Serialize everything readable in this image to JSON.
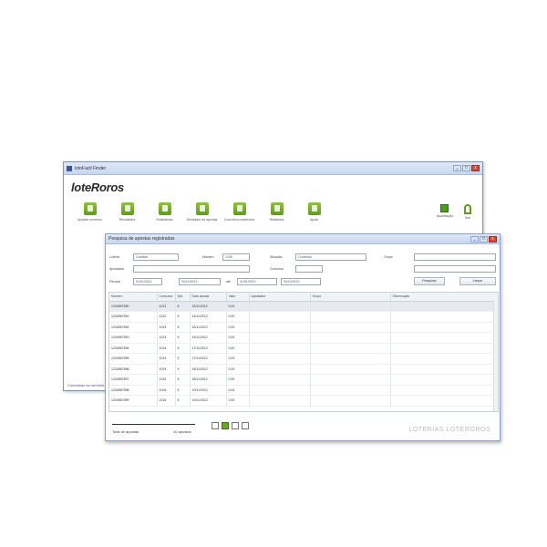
{
  "main_window": {
    "title": "lotoFacil Finder",
    "controls": [
      "_",
      "□",
      "x"
    ],
    "logo": "loteRoros",
    "toolbar": [
      {
        "label": "Apostar números",
        "icon": "bet-icon"
      },
      {
        "label": "Resultados",
        "icon": "results-icon"
      },
      {
        "label": "Estatísticas",
        "icon": "stats-icon"
      },
      {
        "label": "Simulador de apostas",
        "icon": "simulator-icon"
      },
      {
        "label": "Concursos anteriores",
        "icon": "contests-icon"
      },
      {
        "label": "Relatórios",
        "icon": "reports-icon"
      },
      {
        "label": "Ajuda",
        "icon": "help-icon"
      }
    ],
    "right_tools": {
      "update_label": "Atualização",
      "exit_label": "Sair"
    },
    "status": "Conectado ao servidor"
  },
  "dialog": {
    "title": "Pesquisa de apostas registradas",
    "controls": [
      "_",
      "□",
      "x"
    ],
    "form": {
      "loteria_label": "Loteria",
      "loteria_value": "Lotofácil",
      "numero_label": "Número",
      "numero_value": "1245",
      "situacao_label": "Situação",
      "situacao_value": "Conferido",
      "apostador_label": "Apostador",
      "apostador_value": "",
      "grupo_label": "Grupo",
      "grupo_value": "",
      "concurso_label": "Concurso",
      "concurso_value": "",
      "periodo_label": "Período",
      "data_inicio": "01/01/2012",
      "data_fim": "31/12/2012",
      "ate_label": "até",
      "data_inicio2": "01/01/2012",
      "data_fim2": "31/12/2012",
      "pesquisar_label": "Pesquisar",
      "limpar_label": "Limpar"
    },
    "grid": {
      "columns": [
        "Número",
        "Concurso",
        "Qtd.",
        "Data aposta",
        "Valor",
        "Apostador",
        "Grupo",
        "Observação"
      ],
      "rows": [
        [
          "1234567890",
          "1012",
          "5",
          "15/11/2012",
          "0,00"
        ],
        [
          "1234567891",
          "1012",
          "5",
          "15/11/2012",
          "0,00"
        ],
        [
          "1234567892",
          "1013",
          "5",
          "16/11/2012",
          "0,00"
        ],
        [
          "1234567893",
          "1013",
          "5",
          "16/11/2012",
          "0,00"
        ],
        [
          "1234567894",
          "1014",
          "5",
          "17/11/2012",
          "0,00"
        ],
        [
          "1234567895",
          "1014",
          "5",
          "17/11/2012",
          "0,00"
        ],
        [
          "1234567896",
          "1015",
          "5",
          "18/11/2012",
          "0,00"
        ],
        [
          "1234567897",
          "1015",
          "5",
          "18/11/2012",
          "0,00"
        ],
        [
          "1234567898",
          "1016",
          "5",
          "19/11/2012",
          "0,00"
        ],
        [
          "1234567899",
          "1016",
          "5",
          "19/11/2012",
          "0,00"
        ]
      ]
    },
    "footer": {
      "left_label": "Total de apostas",
      "left_value": "10 apostas",
      "brand": "LOTERIAS LOTEROROS"
    }
  }
}
